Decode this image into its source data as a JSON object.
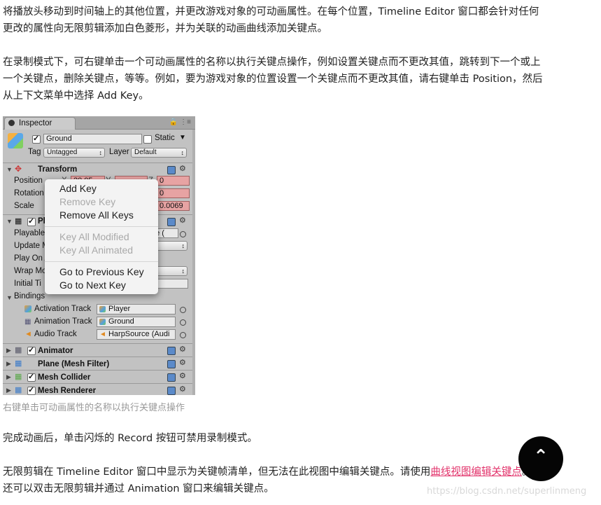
{
  "text": {
    "p1_line1": "将播放头移动到时间轴上的其他位置，并更改游戏对象的可动画属性。在每个位置，Timeline Editor 窗口都会针对任何",
    "p1_line2": "更改的属性向无限剪辑添加白色菱形，并为关联的动画曲线添加关键点。",
    "p2_line1": "在录制模式下，可右键单击一个可动画属性的名称以执行关键点操作，例如设置关键点而不更改其值，跳转到下一个或上",
    "p2_line2": "一个关键点，删除关键点，等等。例如，要为游戏对象的位置设置一个关键点而不更改其值，请右键单击 Position，然后",
    "p2_line3": "从上下文菜单中选择 Add Key。",
    "caption": "右键单击可动画属性的名称以执行关键点操作",
    "p3": "完成动画后，单击闪烁的 Record 按钮可禁用录制模式。",
    "p4_line1_a": "无限剪辑在 Timeline Editor 窗口中显示为关键帧清单，但无法在此视图中编辑关键点。请使用",
    "p4_link": "曲线视图编辑关键点",
    "p4_line1_b": "。",
    "p4_line2": "还可以双击无限剪辑并通过 Animation 窗口来编辑关键点。",
    "watermark": "https://blog.csdn.net/superlinmeng",
    "fab_icon": "chevron-up-icon"
  },
  "inspector": {
    "tab": "Inspector",
    "object_name": "Ground",
    "static_label": "Static",
    "tag_label": "Tag",
    "tag_value": "Untagged",
    "layer_label": "Layer",
    "layer_value": "Default",
    "transform": "Transform",
    "position": "Position",
    "rotation": "Rotation",
    "scale": "Scale",
    "pos_x_label": "X",
    "pos_x": "20.05",
    "pos_y_label": "Y",
    "pos_z_label": "Z",
    "pos_z": "0",
    "rot_z": "0",
    "scale_z": "0.0069",
    "playable_header": "Pl",
    "playable": "Playable",
    "playable_value": "ne (",
    "update": "Update M",
    "playon": "Play On A",
    "wrap": "Wrap Mo",
    "initial": "Initial Ti",
    "bindings": "Bindings",
    "activation_track": "Activation Track",
    "activation_value": "Player",
    "animation_track": "Animation Track",
    "animation_value": "Ground",
    "audio_track": "Audio Track",
    "audio_value": "HarpSource (Audi",
    "animator": "Animator",
    "plane": "Plane (Mesh Filter)",
    "mesh_collider": "Mesh Collider",
    "mesh_renderer": "Mesh Renderer"
  },
  "context_menu": {
    "add_key": "Add Key",
    "remove_key": "Remove Key",
    "remove_all": "Remove All Keys",
    "key_all_modified": "Key All Modified",
    "key_all_animated": "Key All Animated",
    "prev_key": "Go to Previous Key",
    "next_key": "Go to Next Key"
  },
  "colors": {
    "link": "#e2336b",
    "keyed_field": "#e7a3a3",
    "fab": "#050505"
  }
}
